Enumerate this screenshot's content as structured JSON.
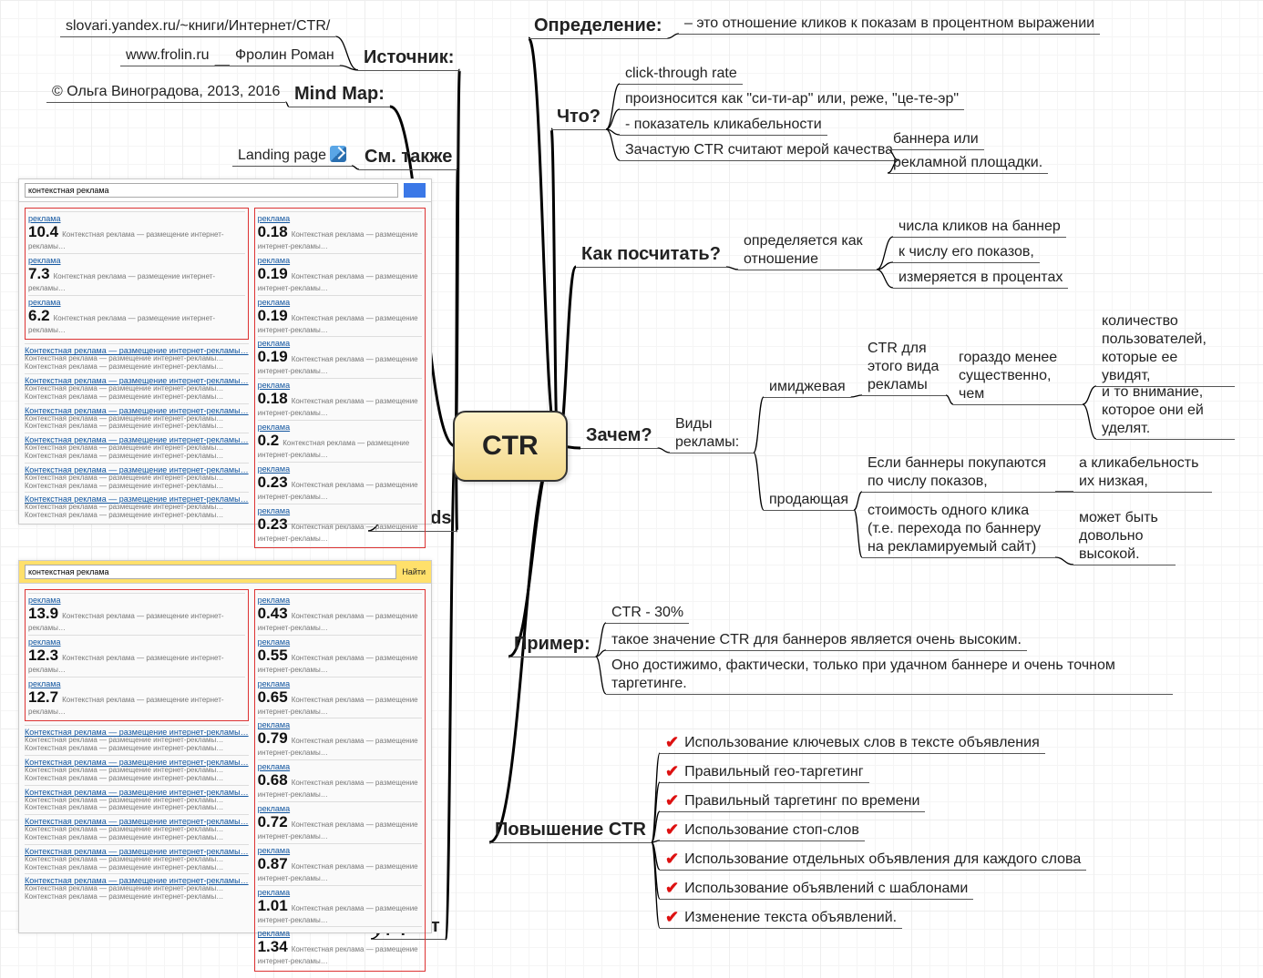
{
  "root": "CTR",
  "left": {
    "source": {
      "label": "Источник:",
      "url": "slovari.yandex.ru/~книги/Интернет/CTR/",
      "site": "www.frolin.ru",
      "author": "Фролин Роман"
    },
    "mindmap": {
      "label": "Mind Map:",
      "credit": "© Ольга Виноградова, 2013, 2016"
    },
    "seealso": {
      "label": "См. также",
      "item": "Landing page"
    },
    "adwords": {
      "label": "Adwords"
    },
    "direct": {
      "label": "Директ"
    }
  },
  "right": {
    "def": {
      "label": "Определение:",
      "text": "– это отношение кликов к показам в процентном выражении"
    },
    "what": {
      "label": "Что?",
      "a": "click-through rate",
      "b": "произносится как \"си-ти-ар\" или, реже, \"це-те-эр\"",
      "c": "- показатель кликабельности",
      "d": "Зачастую CTR считают мерой качества",
      "d1": "баннера или",
      "d2": "рекламной площадки."
    },
    "how": {
      "label": "Как посчитать?",
      "a": "определяется как отношение",
      "a1": "числа кликов на баннер",
      "a2": "к числу его показов,",
      "a3": "измеряется в процентах"
    },
    "why": {
      "label": "Зачем?",
      "kinds": "Виды рекламы:",
      "image": {
        "label": "имиджевая",
        "a": "CTR для этого вида рекламы",
        "b": "гораздо менее существенно, чем",
        "b1": "количество пользователей, которые ее увидят,",
        "b2": "и то внимание, которое они ей уделят."
      },
      "sell": {
        "label": "продающая",
        "a": "Если баннеры покупаются по числу показов,",
        "a1": "а кликабельность их низкая,",
        "b": "стоимость одного клика (т.е. перехода по баннеру на рекламируемый сайт)",
        "b1": "может быть довольно высокой."
      }
    },
    "example": {
      "label": "Пример:",
      "a": "CTR - 30%",
      "b": "такое значение CTR для баннеров является очень высоким.",
      "c": "Оно достижимо, фактически, только при удачном баннере и очень точном таргетинге."
    },
    "improve": {
      "label": "Повышение CTR",
      "items": [
        "Использование ключевых слов в тексте объявления",
        "Правильный гео-таргетинг",
        "Правильный таргетинг по времени",
        "Использование стоп-слов",
        "Использование отдельных объявления для каждого слова",
        "Использование объявлений с шаблонами",
        "Изменение текста объявлений."
      ]
    }
  },
  "shots": {
    "query": "контекстная реклама",
    "adwords_left": [
      "10.4",
      "7.3",
      "6.2"
    ],
    "adwords_right": [
      "0.18",
      "0.19",
      "0.19",
      "0.19",
      "0.18",
      "0.2",
      "0.23",
      "0.23"
    ],
    "direct_left": [
      "13.9",
      "12.3",
      "12.7"
    ],
    "direct_right": [
      "0.43",
      "0.55",
      "0.65",
      "0.79",
      "0.68",
      "0.72",
      "0.87",
      "1.01",
      "1.34"
    ],
    "adhead": "реклама",
    "blurb": "Контекстная реклама — размещение интернет-рекламы…"
  }
}
